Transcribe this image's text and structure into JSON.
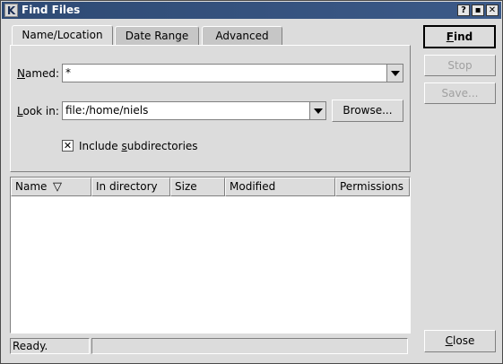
{
  "window": {
    "title": "Find Files",
    "app_icon": "K",
    "title_buttons": [
      {
        "name": "help",
        "glyph": "?"
      },
      {
        "name": "maximize",
        "glyph": "▪"
      },
      {
        "name": "close",
        "glyph": "✕"
      }
    ]
  },
  "tabs": [
    {
      "label": "Name/Location",
      "active": true
    },
    {
      "label": "Date Range",
      "active": false
    },
    {
      "label": "Advanced",
      "active": false
    }
  ],
  "named": {
    "label_u": "N",
    "label_rest": "amed:",
    "value": "*"
  },
  "look_in": {
    "label_u": "L",
    "label_rest": "ook in:",
    "value": "file:/home/niels"
  },
  "browse_button": "Browse...",
  "include_subdirs": {
    "checked": true,
    "mark": "✕",
    "text_pre": "Include ",
    "text_u": "s",
    "text_post": "ubdirectories"
  },
  "columns": [
    {
      "label": "Name",
      "sort_indicator": "▽"
    },
    {
      "label": "In directory"
    },
    {
      "label": "Size"
    },
    {
      "label": "Modified"
    },
    {
      "label": "Permissions"
    }
  ],
  "buttons": {
    "find": {
      "u": "F",
      "rest": "ind",
      "enabled": true
    },
    "stop": {
      "label": "Stop",
      "enabled": false
    },
    "save": {
      "label": "Save...",
      "enabled": false
    },
    "close": {
      "u": "C",
      "rest": "lose",
      "enabled": true
    }
  },
  "status": {
    "text": "Ready.",
    "secondary": ""
  }
}
